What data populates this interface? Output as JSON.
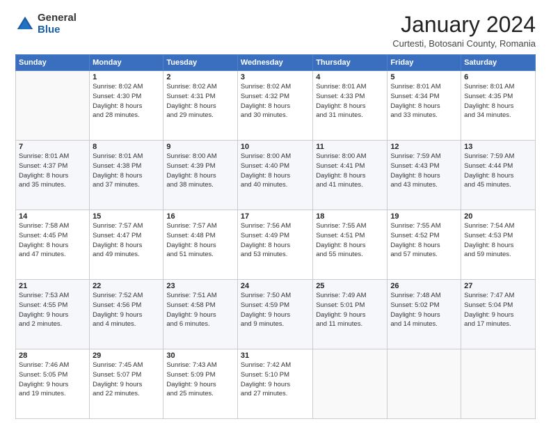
{
  "logo": {
    "general": "General",
    "blue": "Blue"
  },
  "title": "January 2024",
  "subtitle": "Curtesti, Botosani County, Romania",
  "weekdays": [
    "Sunday",
    "Monday",
    "Tuesday",
    "Wednesday",
    "Thursday",
    "Friday",
    "Saturday"
  ],
  "weeks": [
    [
      {
        "day": "",
        "info": ""
      },
      {
        "day": "1",
        "info": "Sunrise: 8:02 AM\nSunset: 4:30 PM\nDaylight: 8 hours\nand 28 minutes."
      },
      {
        "day": "2",
        "info": "Sunrise: 8:02 AM\nSunset: 4:31 PM\nDaylight: 8 hours\nand 29 minutes."
      },
      {
        "day": "3",
        "info": "Sunrise: 8:02 AM\nSunset: 4:32 PM\nDaylight: 8 hours\nand 30 minutes."
      },
      {
        "day": "4",
        "info": "Sunrise: 8:01 AM\nSunset: 4:33 PM\nDaylight: 8 hours\nand 31 minutes."
      },
      {
        "day": "5",
        "info": "Sunrise: 8:01 AM\nSunset: 4:34 PM\nDaylight: 8 hours\nand 33 minutes."
      },
      {
        "day": "6",
        "info": "Sunrise: 8:01 AM\nSunset: 4:35 PM\nDaylight: 8 hours\nand 34 minutes."
      }
    ],
    [
      {
        "day": "7",
        "info": "Sunrise: 8:01 AM\nSunset: 4:37 PM\nDaylight: 8 hours\nand 35 minutes."
      },
      {
        "day": "8",
        "info": "Sunrise: 8:01 AM\nSunset: 4:38 PM\nDaylight: 8 hours\nand 37 minutes."
      },
      {
        "day": "9",
        "info": "Sunrise: 8:00 AM\nSunset: 4:39 PM\nDaylight: 8 hours\nand 38 minutes."
      },
      {
        "day": "10",
        "info": "Sunrise: 8:00 AM\nSunset: 4:40 PM\nDaylight: 8 hours\nand 40 minutes."
      },
      {
        "day": "11",
        "info": "Sunrise: 8:00 AM\nSunset: 4:41 PM\nDaylight: 8 hours\nand 41 minutes."
      },
      {
        "day": "12",
        "info": "Sunrise: 7:59 AM\nSunset: 4:43 PM\nDaylight: 8 hours\nand 43 minutes."
      },
      {
        "day": "13",
        "info": "Sunrise: 7:59 AM\nSunset: 4:44 PM\nDaylight: 8 hours\nand 45 minutes."
      }
    ],
    [
      {
        "day": "14",
        "info": "Sunrise: 7:58 AM\nSunset: 4:45 PM\nDaylight: 8 hours\nand 47 minutes."
      },
      {
        "day": "15",
        "info": "Sunrise: 7:57 AM\nSunset: 4:47 PM\nDaylight: 8 hours\nand 49 minutes."
      },
      {
        "day": "16",
        "info": "Sunrise: 7:57 AM\nSunset: 4:48 PM\nDaylight: 8 hours\nand 51 minutes."
      },
      {
        "day": "17",
        "info": "Sunrise: 7:56 AM\nSunset: 4:49 PM\nDaylight: 8 hours\nand 53 minutes."
      },
      {
        "day": "18",
        "info": "Sunrise: 7:55 AM\nSunset: 4:51 PM\nDaylight: 8 hours\nand 55 minutes."
      },
      {
        "day": "19",
        "info": "Sunrise: 7:55 AM\nSunset: 4:52 PM\nDaylight: 8 hours\nand 57 minutes."
      },
      {
        "day": "20",
        "info": "Sunrise: 7:54 AM\nSunset: 4:53 PM\nDaylight: 8 hours\nand 59 minutes."
      }
    ],
    [
      {
        "day": "21",
        "info": "Sunrise: 7:53 AM\nSunset: 4:55 PM\nDaylight: 9 hours\nand 2 minutes."
      },
      {
        "day": "22",
        "info": "Sunrise: 7:52 AM\nSunset: 4:56 PM\nDaylight: 9 hours\nand 4 minutes."
      },
      {
        "day": "23",
        "info": "Sunrise: 7:51 AM\nSunset: 4:58 PM\nDaylight: 9 hours\nand 6 minutes."
      },
      {
        "day": "24",
        "info": "Sunrise: 7:50 AM\nSunset: 4:59 PM\nDaylight: 9 hours\nand 9 minutes."
      },
      {
        "day": "25",
        "info": "Sunrise: 7:49 AM\nSunset: 5:01 PM\nDaylight: 9 hours\nand 11 minutes."
      },
      {
        "day": "26",
        "info": "Sunrise: 7:48 AM\nSunset: 5:02 PM\nDaylight: 9 hours\nand 14 minutes."
      },
      {
        "day": "27",
        "info": "Sunrise: 7:47 AM\nSunset: 5:04 PM\nDaylight: 9 hours\nand 17 minutes."
      }
    ],
    [
      {
        "day": "28",
        "info": "Sunrise: 7:46 AM\nSunset: 5:05 PM\nDaylight: 9 hours\nand 19 minutes."
      },
      {
        "day": "29",
        "info": "Sunrise: 7:45 AM\nSunset: 5:07 PM\nDaylight: 9 hours\nand 22 minutes."
      },
      {
        "day": "30",
        "info": "Sunrise: 7:43 AM\nSunset: 5:09 PM\nDaylight: 9 hours\nand 25 minutes."
      },
      {
        "day": "31",
        "info": "Sunrise: 7:42 AM\nSunset: 5:10 PM\nDaylight: 9 hours\nand 27 minutes."
      },
      {
        "day": "",
        "info": ""
      },
      {
        "day": "",
        "info": ""
      },
      {
        "day": "",
        "info": ""
      }
    ]
  ]
}
